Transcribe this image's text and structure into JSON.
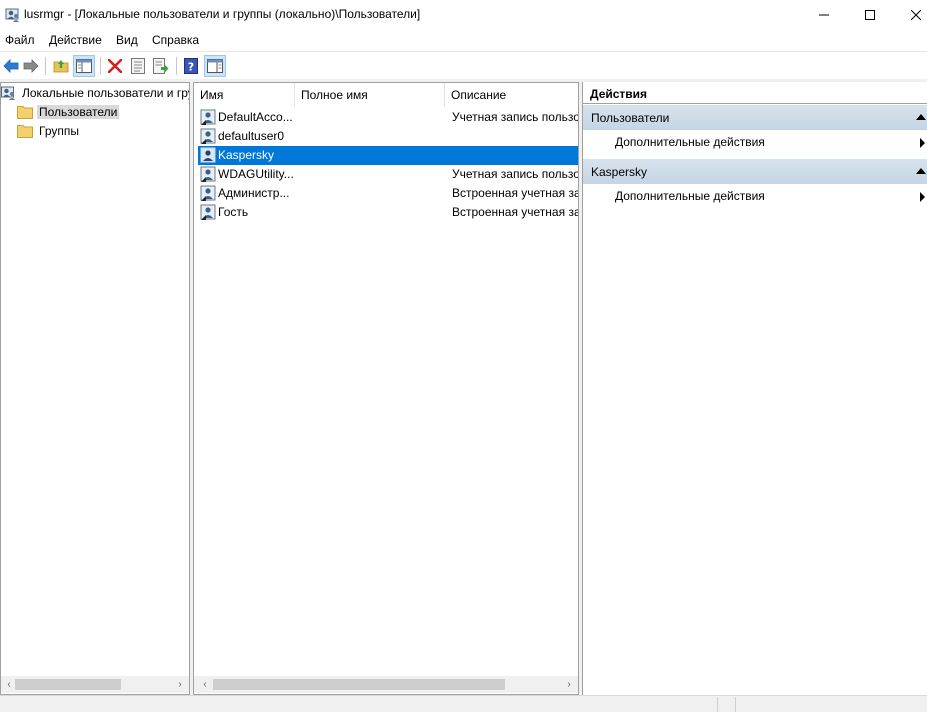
{
  "window": {
    "title": "lusrmgr - [Локальные пользователи и группы (локально)\\Пользователи]"
  },
  "menu": [
    "Файл",
    "Действие",
    "Вид",
    "Справка"
  ],
  "toolbar": {
    "buttons": [
      "back-icon",
      "forward-icon",
      "up-folder-icon",
      "show-hide-tree-icon",
      "delete-icon",
      "properties-icon",
      "export-list-icon",
      "help-icon",
      "show-action-pane-icon"
    ]
  },
  "tree": {
    "root": "Локальные пользователи и гру",
    "items": [
      "Пользователи",
      "Группы"
    ],
    "selected": "Пользователи"
  },
  "list": {
    "columns": [
      "Имя",
      "Полное имя",
      "Описание"
    ],
    "rows": [
      {
        "name": "DefaultAcco...",
        "full": "",
        "desc": "Учетная запись пользо"
      },
      {
        "name": "defaultuser0",
        "full": "",
        "desc": ""
      },
      {
        "name": "Kaspersky",
        "full": "",
        "desc": ""
      },
      {
        "name": "WDAGUtility...",
        "full": "",
        "desc": "Учетная запись пользо"
      },
      {
        "name": "Администр...",
        "full": "",
        "desc": "Встроенная учетная зап"
      },
      {
        "name": "Гость",
        "full": "",
        "desc": "Встроенная учетная зап"
      }
    ],
    "selected_row": "Kaspersky"
  },
  "actions": {
    "title": "Действия",
    "groups": [
      {
        "label": "Пользователи",
        "items": [
          "Дополнительные действия"
        ]
      },
      {
        "label": "Kaspersky",
        "items": [
          "Дополнительные действия"
        ]
      }
    ]
  },
  "colors": {
    "selection": "#0078d7",
    "action_header": "#c5d5e4",
    "pane_border": "#a0a0a0"
  }
}
